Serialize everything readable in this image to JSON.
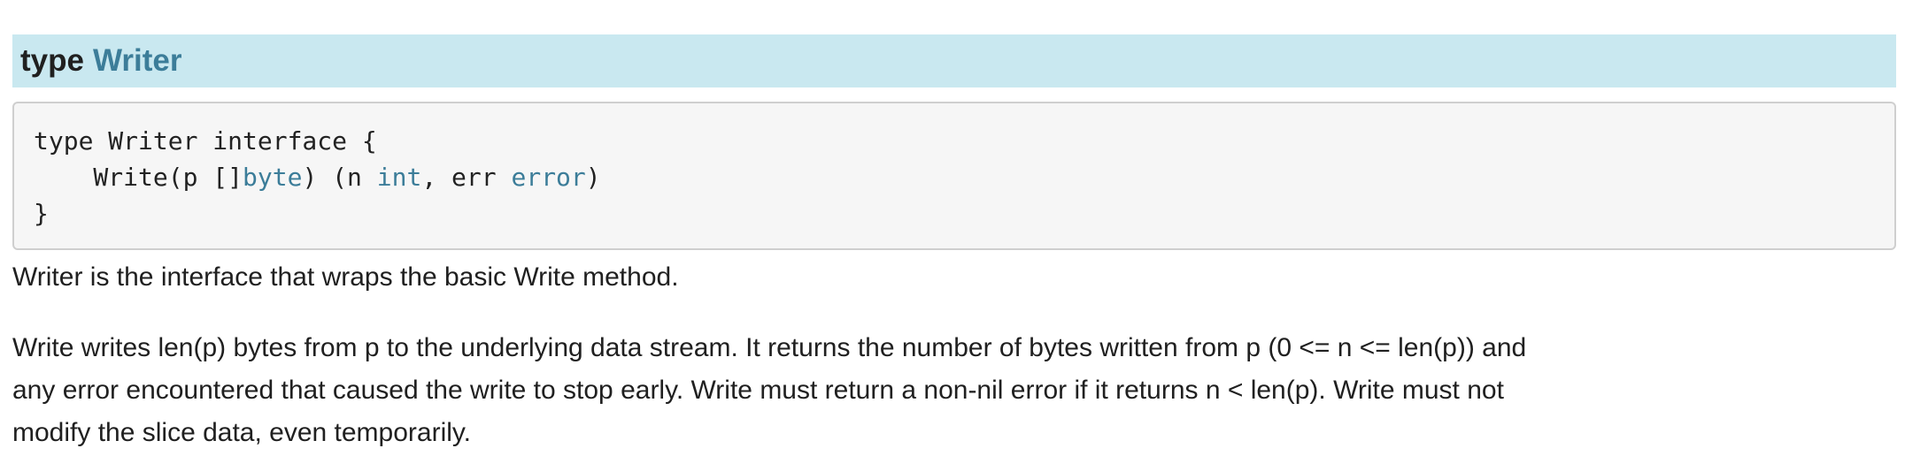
{
  "header": {
    "keyword": "type",
    "name": "Writer"
  },
  "code": {
    "line1": "type Writer interface {",
    "line2_prefix": "    Write(p []",
    "line2_byte": "byte",
    "line2_mid": ") (n ",
    "line2_int": "int",
    "line2_mid2": ", err ",
    "line2_error": "error",
    "line2_suffix": ")",
    "line3": "}"
  },
  "description": {
    "para1": "Writer is the interface that wraps the basic Write method.",
    "para2_lines": [
      "Write writes len(p) bytes from p to the underlying data stream. It returns the number of bytes written from p (0 <= n <= len(p)) and",
      "any error encountered that caused the write to stop early. Write must return a non-nil error if it returns n < len(p). Write must not",
      "modify the slice data, even temporarily."
    ]
  },
  "colors": {
    "header_background": "#c9e8f0",
    "link": "#3c7d99",
    "code_background": "#f6f6f6",
    "code_border": "#cfcfcf",
    "text": "#202020"
  }
}
